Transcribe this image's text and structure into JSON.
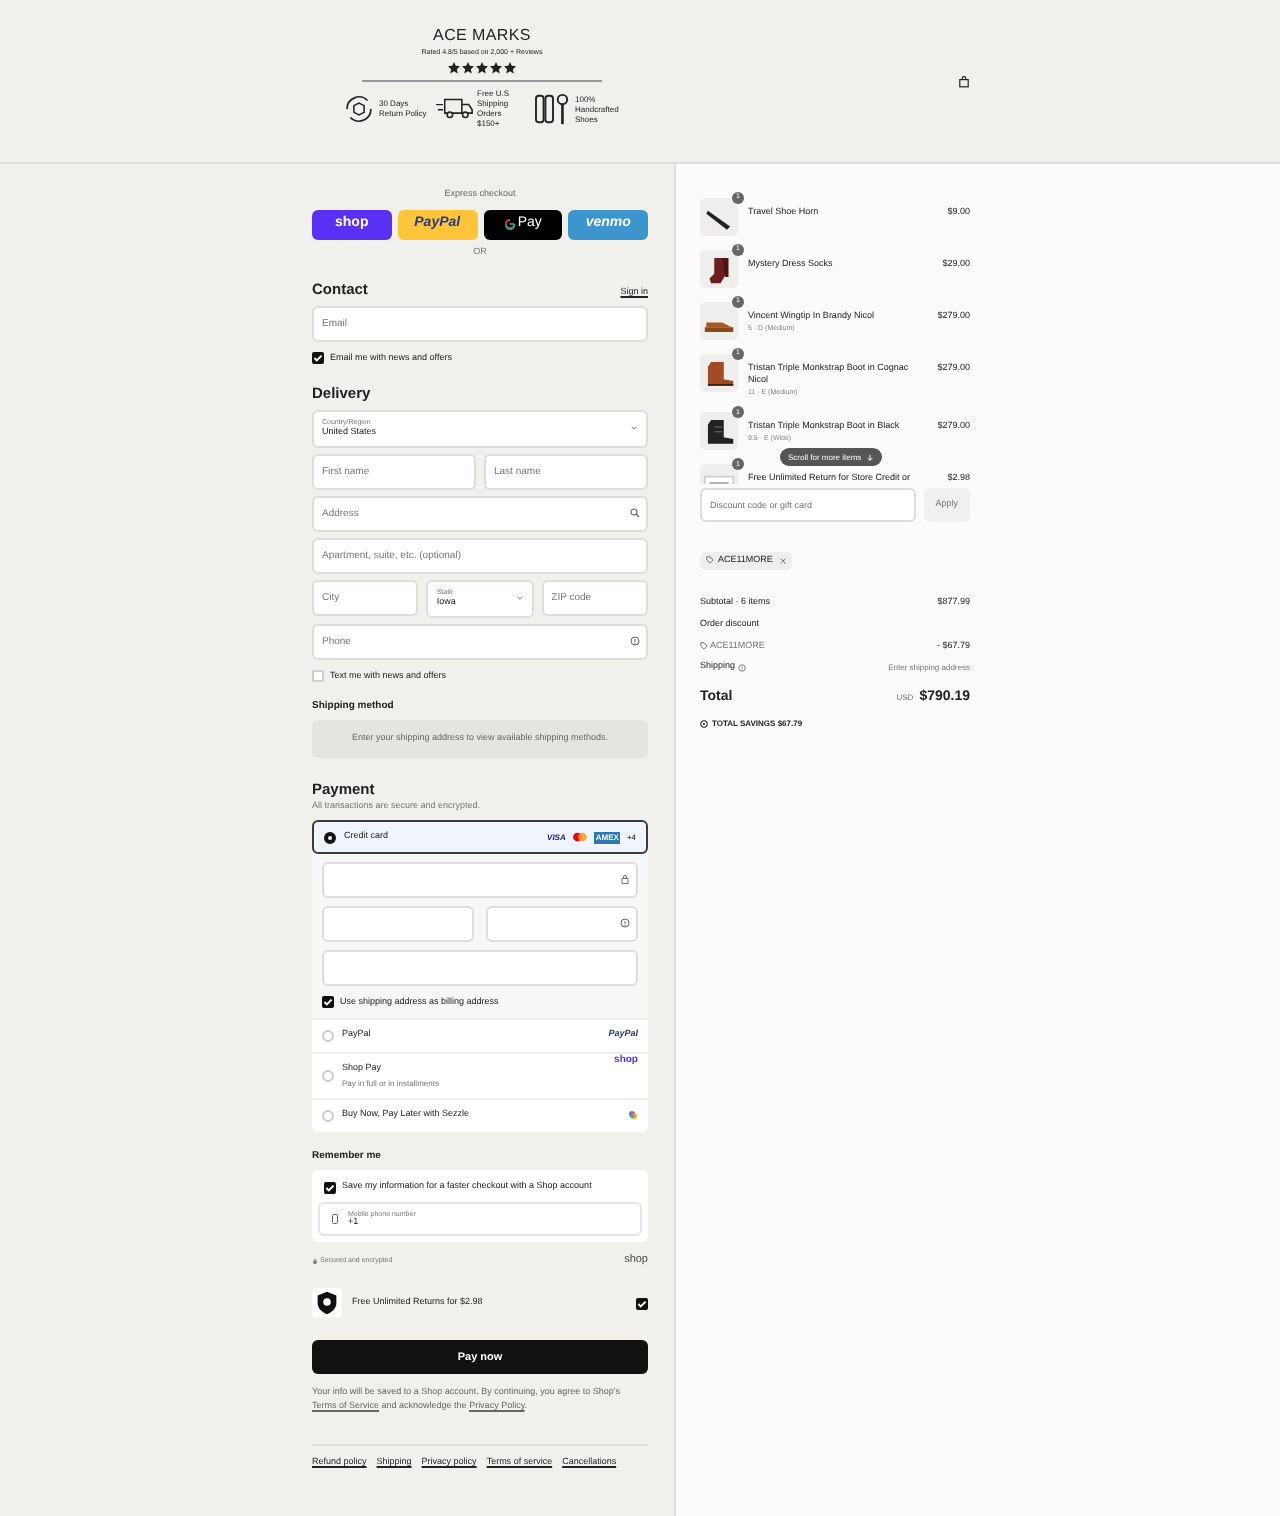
{
  "header": {
    "brand": "ACE MARKS",
    "rating": "Rated 4.8/5 based on 2,000 + Reviews",
    "stars": 5,
    "features": [
      {
        "kind": "return",
        "text": "30 Days Return Policy"
      },
      {
        "kind": "truck",
        "text": "Free U.S Shipping Orders $150+"
      },
      {
        "kind": "tools",
        "text": "100% Handcrafted Shoes"
      }
    ]
  },
  "express": {
    "label": "Express checkout",
    "buttons": [
      {
        "kind": "shop",
        "label": "shop"
      },
      {
        "kind": "paypal",
        "label": "PayPal"
      },
      {
        "kind": "gpay",
        "label": "Pay"
      },
      {
        "kind": "venmo",
        "label": "venmo"
      }
    ],
    "separator": "OR"
  },
  "contact": {
    "title": "Contact",
    "sign_in": "Sign in",
    "email_placeholder": "Email",
    "newsletter": {
      "label": "Email me with news and offers",
      "checked": true
    }
  },
  "delivery": {
    "title": "Delivery",
    "country": {
      "label": "Country/Region",
      "value": "United States"
    },
    "first_name": {
      "placeholder": "First name"
    },
    "last_name": {
      "placeholder": "Last name"
    },
    "address": {
      "placeholder": "Address"
    },
    "apartment": {
      "placeholder": "Apartment, suite, etc. (optional)"
    },
    "city": {
      "placeholder": "City"
    },
    "state": {
      "label": "State",
      "value": "Iowa"
    },
    "zip": {
      "placeholder": "ZIP code"
    },
    "phone": {
      "placeholder": "Phone"
    },
    "sms": {
      "label": "Text me with news and offers",
      "checked": false
    }
  },
  "shipping_method": {
    "title": "Shipping method",
    "message": "Enter your shipping address to view available shipping methods."
  },
  "payment": {
    "title": "Payment",
    "subtitle": "All transactions are secure and encrypted.",
    "methods": [
      {
        "kind": "card",
        "label": "Credit card",
        "selected": true,
        "brands": [
          "VISA",
          "AMEX"
        ],
        "more": "+4"
      },
      {
        "kind": "paypal",
        "label": "PayPal",
        "selected": false,
        "logo": "PayPal"
      },
      {
        "kind": "shoppay",
        "label": "Shop Pay",
        "sublabel": "Pay in full or in installments",
        "selected": false,
        "logo": "shop"
      },
      {
        "kind": "sezzle",
        "label": "Buy Now, Pay Later with Sezzle",
        "selected": false
      }
    ],
    "billing": {
      "label": "Use shipping address as billing address",
      "checked": true
    }
  },
  "remember": {
    "title": "Remember me",
    "save": {
      "label": "Save my information for a faster checkout with a Shop account",
      "checked": true
    },
    "phone": {
      "label": "Mobile phone number",
      "value": "+1"
    },
    "secured": "Secured and encrypted",
    "logo": "shop"
  },
  "returns": {
    "label": "Free Unlimited Returns for $2.98",
    "checked": true
  },
  "pay_button": "Pay now",
  "terms": {
    "before": "Your info will be saved to a Shop account. By continuing, you agree to Shop's",
    "link1": "Terms of Service",
    "middle": "and acknowledge the",
    "link2": "Privacy Policy",
    "after": "."
  },
  "footer_links": [
    "Refund policy",
    "Shipping",
    "Privacy policy",
    "Terms of service",
    "Cancellations"
  ],
  "cart": {
    "items": [
      {
        "kind": "horn",
        "name": "Travel Shoe Horn",
        "quantity": "1",
        "price": "$9.00"
      },
      {
        "kind": "socks",
        "name": "Mystery Dress Socks",
        "quantity": "1",
        "price": "$29.00"
      },
      {
        "kind": "shoe",
        "name": "Vincent Wingtip In Brandy Nicol",
        "variant": "5 · D (Medium)",
        "quantity": "1",
        "price": "$279.00"
      },
      {
        "kind": "boot",
        "name": "Tristan Triple Monkstrap Boot in Cognac Nicol",
        "variant": "11 · E (Medium)",
        "quantity": "1",
        "price": "$279.00"
      },
      {
        "kind": "blackboot",
        "name": "Tristan Triple Monkstrap Boot in Black",
        "variant": "9.5 · E (Wide)",
        "quantity": "1",
        "price": "$279.00"
      },
      {
        "kind": "card",
        "name": "Free Unlimited Return for Store Credit or",
        "quantity": "1",
        "price": "$2.98"
      }
    ],
    "scroll_hint": "Scroll for more items",
    "discount_placeholder": "Discount code or gift card",
    "apply": "Apply",
    "applied_code": "ACE11MORE"
  },
  "summary": {
    "subtotal_label": "Subtotal · 6 items",
    "subtotal": "$877.99",
    "discount_label": "Order discount",
    "discount_code": "ACE11MORE",
    "discount": "- $67.79",
    "shipping_label": "Shipping",
    "shipping": "Enter shipping address",
    "total_label": "Total",
    "currency": "USD",
    "total": "$790.19",
    "savings_label": "TOTAL SAVINGS",
    "savings": "$67.79"
  }
}
